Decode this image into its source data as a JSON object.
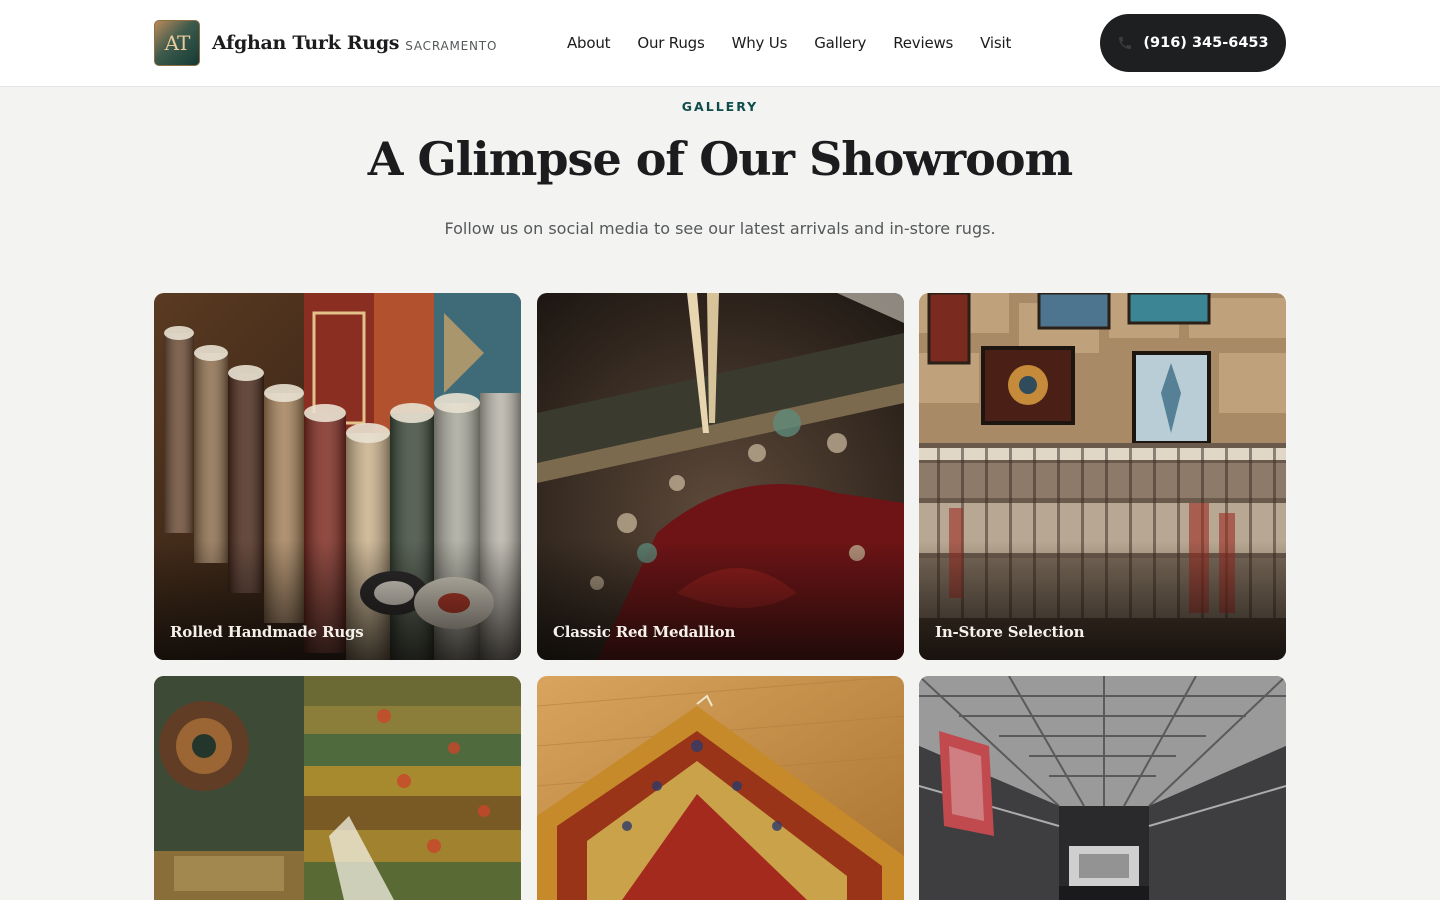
{
  "brand": {
    "logo_initials": "AT",
    "name": "Afghan Turk Rugs",
    "city": "SACRAMENTO"
  },
  "nav": {
    "items": [
      {
        "label": "About"
      },
      {
        "label": "Our Rugs"
      },
      {
        "label": "Why Us"
      },
      {
        "label": "Gallery"
      },
      {
        "label": "Reviews"
      },
      {
        "label": "Visit"
      }
    ],
    "phone": "(916) 345-6453",
    "phone_icon": "phone-icon"
  },
  "section": {
    "eyebrow": "GALLERY",
    "title": "A Glimpse of Our Showroom",
    "subtitle": "Follow us on social media to see our latest arrivals and in-store rugs."
  },
  "gallery": {
    "items": [
      {
        "caption": "Rolled Handmade Rugs"
      },
      {
        "caption": "Classic Red Medallion"
      },
      {
        "caption": "In-Store Selection"
      },
      {
        "caption": ""
      },
      {
        "caption": ""
      },
      {
        "caption": ""
      }
    ]
  },
  "colors": {
    "accent": "#0f4c4c",
    "button": "#1d1f21",
    "background": "#f3f3f1"
  }
}
